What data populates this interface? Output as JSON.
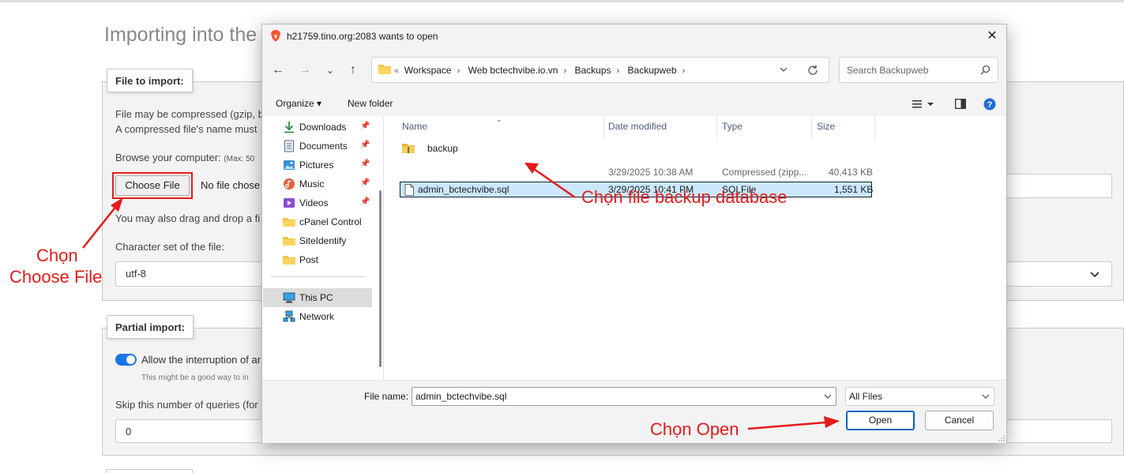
{
  "page": {
    "title": "Importing into the",
    "file_legend": "File to import:",
    "compress_line1": "File may be compressed (gzip, b",
    "compress_line2": "A compressed file's name must",
    "browse_label": "Browse your computer:",
    "browse_max": "(Max: 50",
    "choose_file": "Choose File",
    "no_file": "No file chose",
    "drag_drop": "You may also drag and drop a fi",
    "charset_label": "Character set of the file:",
    "charset_value": "utf-8",
    "partial_legend": "Partial import:",
    "allow_interrupt": "Allow the interruption of ar",
    "interrupt_hint": "This might be a good way to in",
    "skip_label": "Skip this number of queries (for",
    "skip_value": "0"
  },
  "annotations": {
    "choose_file_line1": "Chọn",
    "choose_file_line2": "Choose File",
    "select_backup": "Chọn file backup database",
    "choose_open": "Chọn Open",
    "color": "#e41b1b"
  },
  "dialog": {
    "title": "h21759.tino.org:2083 wants to open",
    "close": "✕",
    "breadcrumb": [
      "Workspace",
      "Web bctechvibe.io.vn",
      "Backups",
      "Backupweb"
    ],
    "breadcrumb_prefix": "«",
    "search_placeholder": "Search Backupweb",
    "organize": "Organize ▾",
    "new_folder": "New folder",
    "nav": [
      {
        "label": "Downloads",
        "icon": "download-icon",
        "pinned": true
      },
      {
        "label": "Documents",
        "icon": "documents-icon",
        "pinned": true
      },
      {
        "label": "Pictures",
        "icon": "pictures-icon",
        "pinned": true
      },
      {
        "label": "Music",
        "icon": "music-icon",
        "pinned": true
      },
      {
        "label": "Videos",
        "icon": "videos-icon",
        "pinned": true
      },
      {
        "label": "cPanel Control",
        "icon": "folder-icon",
        "pinned": false
      },
      {
        "label": "SiteIdentify",
        "icon": "folder-icon",
        "pinned": false
      },
      {
        "label": "Post",
        "icon": "folder-icon",
        "pinned": false
      },
      {
        "label": "This PC",
        "icon": "this-pc-icon",
        "pinned": false
      },
      {
        "label": "Network",
        "icon": "network-icon",
        "pinned": false
      }
    ],
    "columns": [
      "Name",
      "Date modified",
      "Type",
      "Size"
    ],
    "files": [
      {
        "name": "backup",
        "date": "3/29/2025 10:38 AM",
        "type": "Compressed (zipp...",
        "size": "40,413 KB",
        "icon": "zip-folder-icon",
        "selected": false
      },
      {
        "name": "admin_bctechvibe.sql",
        "date": "3/29/2025 10:41 PM",
        "type": "SQLFile",
        "size": "1,551 KB",
        "icon": "file-icon",
        "selected": true
      }
    ],
    "file_name_label": "File name:",
    "file_name_value": "admin_bctechvibe.sql",
    "file_type_value": "All Files",
    "open": "Open",
    "cancel": "Cancel"
  }
}
